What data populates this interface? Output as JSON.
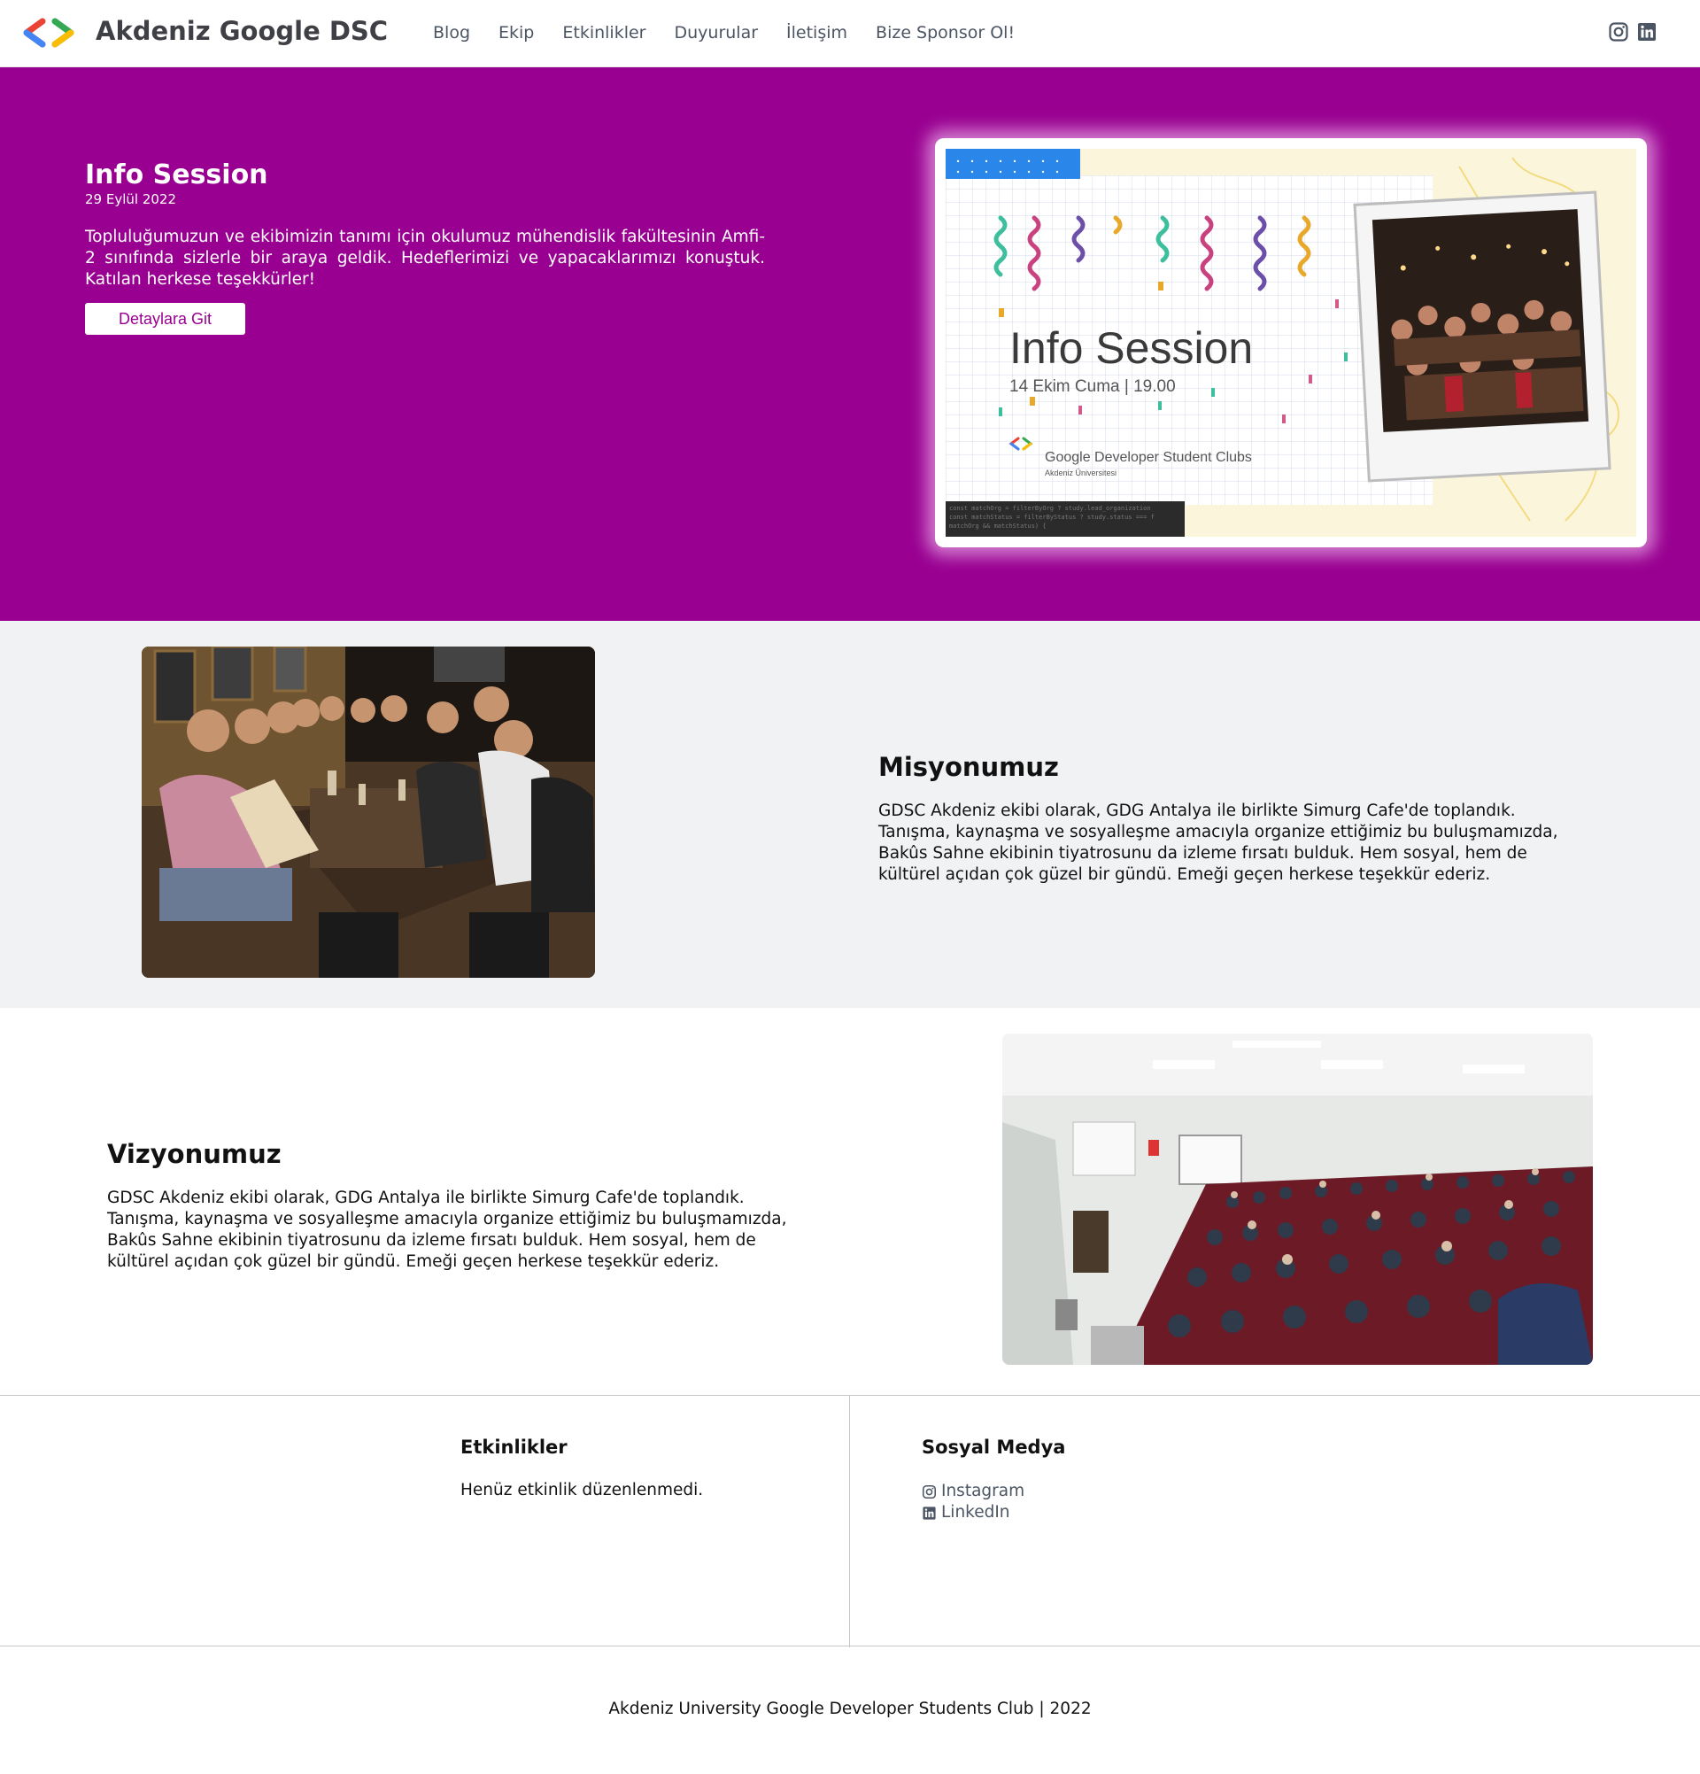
{
  "nav": {
    "brand": "Akdeniz Google DSC",
    "links": [
      "Blog",
      "Ekip",
      "Etkinlikler",
      "Duyurular",
      "İletişim",
      "Bize Sponsor Ol!"
    ],
    "social_icons": [
      "instagram-icon",
      "linkedin-icon"
    ]
  },
  "hero": {
    "title": "Info Session",
    "date": "29 Eylül 2022",
    "text": "Topluluğumuzun ve ekibimizin tanımı için okulumuz mühendislik fakültesinin Amfi-2 sınıfında sizlerle bir araya geldik. Hedeflerimizi ve yapacaklarımızı konuştuk. Katılan herkese teşekkürler!",
    "button": "Detaylara Git",
    "poster": {
      "title": "Info Session",
      "subtitle": "14 Ekim Cuma  |  19.00",
      "club": "Google Developer Student Clubs",
      "university": "Akdeniz Üniversitesi"
    }
  },
  "mission": {
    "title": "Misyonumuz",
    "text": "GDSC Akdeniz ekibi olarak, GDG Antalya ile birlikte Simurg Cafe'de toplandık. Tanışma, kaynaşma ve sosyalleşme amacıyla organize ettiğimiz bu buluşmamızda, Bakûs Sahne ekibinin tiyatrosunu da izleme fırsatı bulduk. Hem sosyal, hem de kültürel açıdan çok güzel bir gündü. Emeği geçen herkese teşekkür ederiz."
  },
  "vision": {
    "title": "Vizyonumuz",
    "text": "GDSC Akdeniz ekibi olarak, GDG Antalya ile birlikte Simurg Cafe'de toplandık. Tanışma, kaynaşma ve sosyalleşme amacıyla organize ettiğimiz bu buluşmamızda, Bakûs Sahne ekibinin tiyatrosunu da izleme fırsatı bulduk. Hem sosyal, hem de kültürel açıdan çok güzel bir gündü. Emeği geçen herkese teşekkür ederiz."
  },
  "footer": {
    "events_heading": "Etkinlikler",
    "events_text": "Henüz etkinlik düzenlenmedi.",
    "social_heading": "Sosyal Medya",
    "social": [
      {
        "label": "Instagram",
        "icon": "instagram-icon"
      },
      {
        "label": "LinkedIn",
        "icon": "linkedin-icon"
      }
    ],
    "copyright": "Akdeniz University Google Developer Students Club | 2022"
  },
  "colors": {
    "hero_bg": "#990091",
    "section_alt_bg": "#f1f2f4",
    "nav_text": "#4b5563"
  }
}
